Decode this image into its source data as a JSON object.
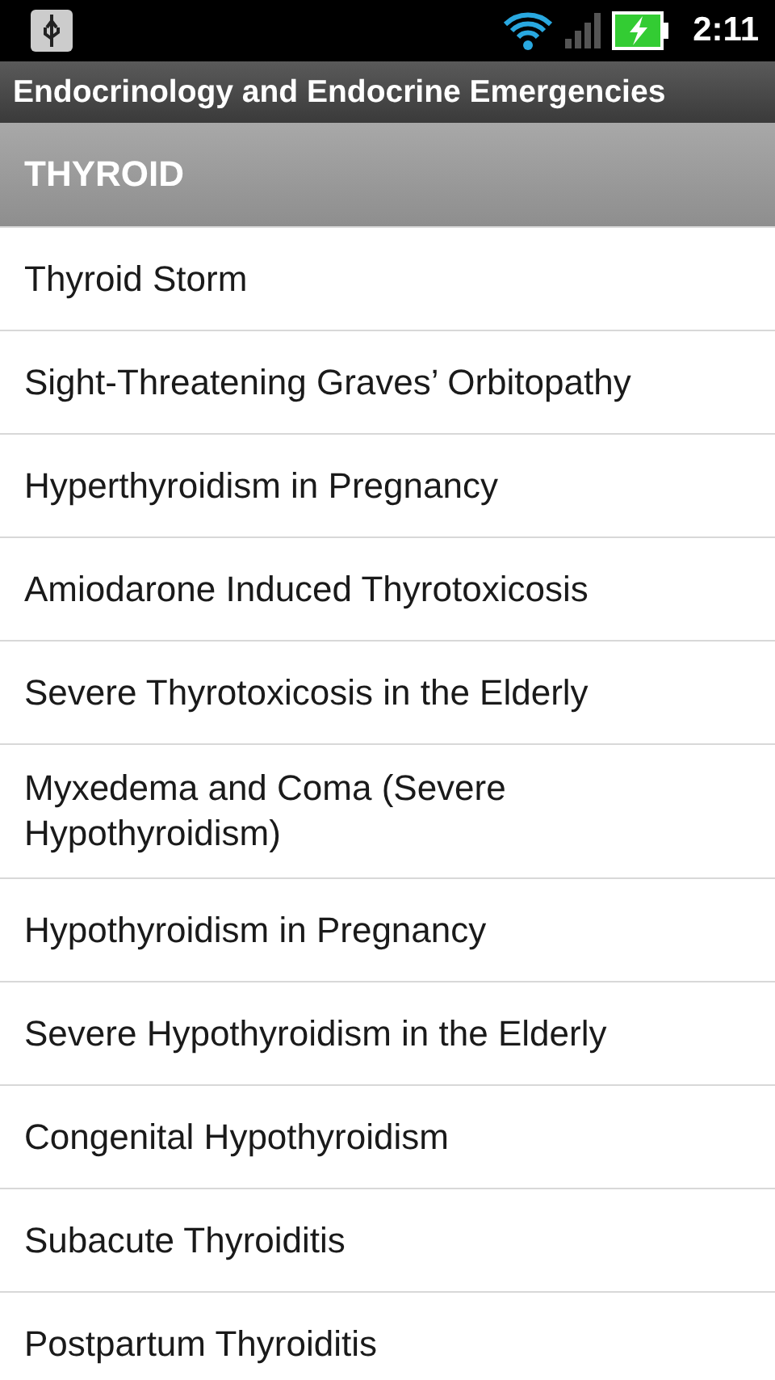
{
  "status_bar": {
    "time": "2:11"
  },
  "title_bar": {
    "title": "Endocrinology and Endocrine Emergencies"
  },
  "section": {
    "header": "THYROID"
  },
  "items": [
    {
      "label": "Thyroid Storm"
    },
    {
      "label": "Sight-Threatening Graves’ Orbitopathy"
    },
    {
      "label": "Hyperthyroidism in Pregnancy"
    },
    {
      "label": "Amiodarone Induced Thyrotoxicosis"
    },
    {
      "label": "Severe Thyrotoxicosis in the Elderly"
    },
    {
      "label": "Myxedema and Coma (Severe Hypothyroidism)"
    },
    {
      "label": "Hypothyroidism in Pregnancy"
    },
    {
      "label": "Severe Hypothyroidism in the Elderly"
    },
    {
      "label": "Congenital Hypothyroidism"
    },
    {
      "label": "Subacute Thyroiditis"
    },
    {
      "label": "Postpartum Thyroiditis"
    }
  ]
}
